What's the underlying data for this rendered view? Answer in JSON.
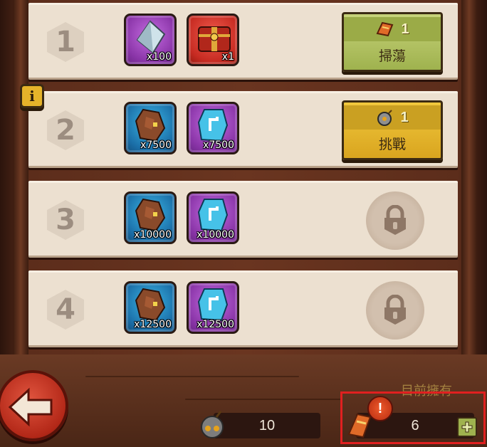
{
  "stages": [
    {
      "number": "1",
      "rewards": [
        {
          "icon": "crystal-icon",
          "qty": "x100",
          "frame": "purple"
        },
        {
          "icon": "treasure-chest-icon",
          "qty": "x1",
          "frame": "red"
        }
      ],
      "action": {
        "type": "sweep",
        "cost": "1",
        "label": "掃蕩",
        "cost_icon": "scroll-ticket-icon"
      }
    },
    {
      "number": "2",
      "rewards": [
        {
          "icon": "ore-icon",
          "qty": "x7500",
          "frame": "blue"
        },
        {
          "icon": "rune-stone-icon",
          "qty": "x7500",
          "frame": "purple"
        }
      ],
      "action": {
        "type": "challenge",
        "cost": "1",
        "label": "挑戰",
        "cost_icon": "bomb-icon"
      }
    },
    {
      "number": "3",
      "rewards": [
        {
          "icon": "ore-icon",
          "qty": "x10000",
          "frame": "blue"
        },
        {
          "icon": "rune-stone-icon",
          "qty": "x10000",
          "frame": "purple"
        }
      ],
      "locked": true
    },
    {
      "number": "4",
      "rewards": [
        {
          "icon": "ore-icon",
          "qty": "x12500",
          "frame": "blue"
        },
        {
          "icon": "rune-stone-icon",
          "qty": "x12500",
          "frame": "purple"
        }
      ],
      "locked": true
    }
  ],
  "info_label": "i",
  "owned_label": "目前擁有",
  "currencies": {
    "bombs": {
      "icon": "bomb-icon",
      "value": "10"
    },
    "scrolls": {
      "icon": "scroll-ticket-icon",
      "value": "6",
      "alert": "!"
    }
  },
  "colors": {
    "highlight": "#e02020",
    "sweep_button": "#9fb24e",
    "challenge_button": "#d9a51f"
  }
}
